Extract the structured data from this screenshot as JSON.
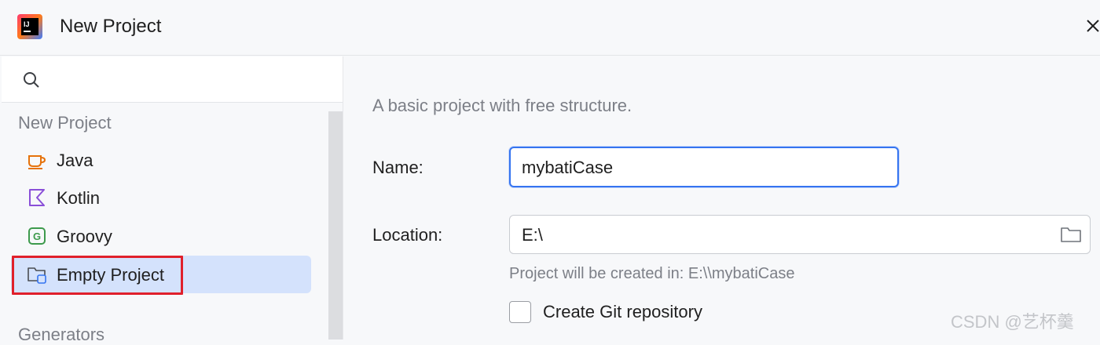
{
  "window": {
    "title": "New Project"
  },
  "sidebar": {
    "search_placeholder": "",
    "section_new_project": "New Project",
    "items": [
      {
        "label": "Java",
        "icon": "java-cup-icon"
      },
      {
        "label": "Kotlin",
        "icon": "kotlin-icon"
      },
      {
        "label": "Groovy",
        "icon": "groovy-icon"
      },
      {
        "label": "Empty Project",
        "icon": "empty-project-folder-icon",
        "selected": true
      }
    ],
    "section_generators": "Generators"
  },
  "main": {
    "description": "A basic project with free structure.",
    "name_label": "Name:",
    "name_value": "mybatiCase",
    "location_label": "Location:",
    "location_value": "E:\\",
    "location_hint": "Project will be created in: E:\\\\mybatiCase",
    "git_checkbox_label": "Create Git repository",
    "git_checkbox_checked": false
  },
  "watermark": "CSDN @艺杯羹",
  "colors": {
    "accent": "#3574f0",
    "selected_bg": "#d4e2fc",
    "highlight_border": "#e0202b",
    "muted_text": "#7c7f87"
  }
}
